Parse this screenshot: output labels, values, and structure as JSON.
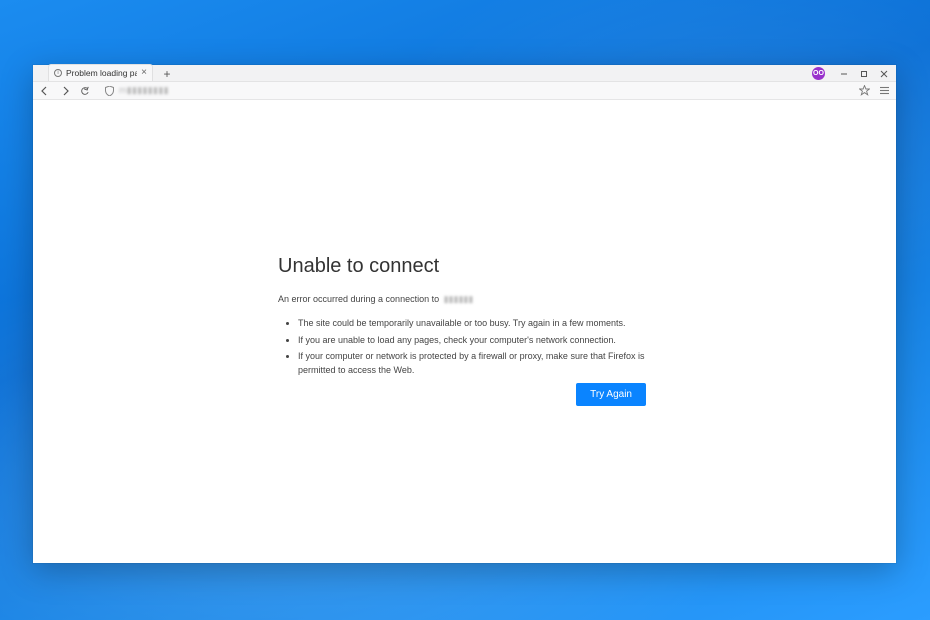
{
  "tab": {
    "title": "Problem loading page",
    "info_icon_char": "i",
    "close_char": "×"
  },
  "newtab": {
    "char": "+"
  },
  "profile": {
    "initials": "OO"
  },
  "toolbar": {
    "url_placeholder": "m▮▮▮▮▮▮▮▮"
  },
  "error": {
    "title": "Unable to connect",
    "desc_prefix": "An error occurred during a connection to",
    "desc_host": "▮▮▮▮▮▮",
    "bullets": [
      "The site could be temporarily unavailable or too busy. Try again in a few moments.",
      "If you are unable to load any pages, check your computer's network connection.",
      "If your computer or network is protected by a firewall or proxy, make sure that Firefox is permitted to access the Web."
    ],
    "try_again_label": "Try Again"
  }
}
